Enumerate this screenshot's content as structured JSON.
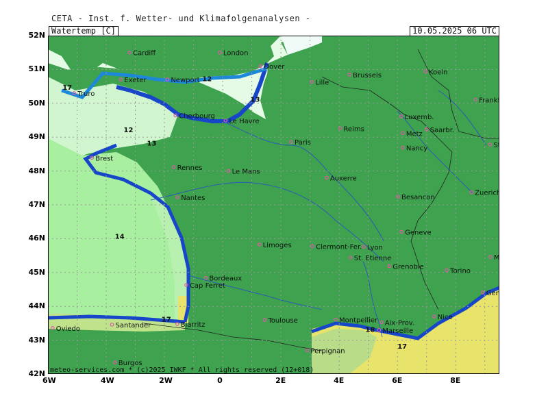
{
  "header": {
    "title": "CETA - Inst. f. Wetter- und Klimafolgenanalysen -"
  },
  "param_box": "Watertemp [C]",
  "date_box": "10.05.2025 06 UTC",
  "footer": "meteo-services.com * (c)2025 IWKF * All rights reserved (12+018)",
  "lat_labels": [
    "52N",
    "51N",
    "50N",
    "49N",
    "48N",
    "47N",
    "46N",
    "45N",
    "44N",
    "43N",
    "42N"
  ],
  "lon_labels": [
    "6W",
    "4W",
    "2W",
    "0",
    "2E",
    "4E",
    "6E",
    "8E"
  ],
  "cities": [
    {
      "name": "Cardiff",
      "lon": -3.2,
      "lat": 51.5
    },
    {
      "name": "London",
      "lon": -0.1,
      "lat": 51.5
    },
    {
      "name": "Dover",
      "lon": 1.3,
      "lat": 51.1
    },
    {
      "name": "Exeter",
      "lon": -3.5,
      "lat": 50.7
    },
    {
      "name": "Newport",
      "lon": -1.9,
      "lat": 50.7
    },
    {
      "name": "Truro",
      "lon": -5.1,
      "lat": 50.3
    },
    {
      "name": "Lille",
      "lon": 3.06,
      "lat": 50.63
    },
    {
      "name": "Brussels",
      "lon": 4.35,
      "lat": 50.85
    },
    {
      "name": "Koeln",
      "lon": 6.96,
      "lat": 50.94
    },
    {
      "name": "Frankfurt",
      "lon": 8.68,
      "lat": 50.11
    },
    {
      "name": "Le Havre",
      "lon": 0.1,
      "lat": 49.49
    },
    {
      "name": "Cherbourg",
      "lon": -1.62,
      "lat": 49.64
    },
    {
      "name": "Reims",
      "lon": 4.03,
      "lat": 49.26
    },
    {
      "name": "Luxemb.",
      "lon": 6.13,
      "lat": 49.61
    },
    {
      "name": "Metz",
      "lon": 6.18,
      "lat": 49.12
    },
    {
      "name": "Saarbr.",
      "lon": 7.0,
      "lat": 49.23
    },
    {
      "name": "Paris",
      "lon": 2.35,
      "lat": 48.86
    },
    {
      "name": "Nancy",
      "lon": 6.18,
      "lat": 48.69
    },
    {
      "name": "Stuttgart",
      "lon": 9.18,
      "lat": 48.78
    },
    {
      "name": "Brest",
      "lon": -4.49,
      "lat": 48.39
    },
    {
      "name": "Rennes",
      "lon": -1.68,
      "lat": 48.11
    },
    {
      "name": "Le Mans",
      "lon": 0.2,
      "lat": 48.0
    },
    {
      "name": "Auxerre",
      "lon": 3.57,
      "lat": 47.8
    },
    {
      "name": "Nantes",
      "lon": -1.55,
      "lat": 47.22
    },
    {
      "name": "Besancon",
      "lon": 6.02,
      "lat": 47.24
    },
    {
      "name": "Zuerich",
      "lon": 8.54,
      "lat": 47.37
    },
    {
      "name": "Geneve",
      "lon": 6.14,
      "lat": 46.2
    },
    {
      "name": "Limoges",
      "lon": 1.26,
      "lat": 45.83
    },
    {
      "name": "Clermont-Fer.",
      "lon": 3.08,
      "lat": 45.78
    },
    {
      "name": "Lyon",
      "lon": 4.84,
      "lat": 45.76
    },
    {
      "name": "St. Etienne",
      "lon": 4.39,
      "lat": 45.44
    },
    {
      "name": "Grenoble",
      "lon": 5.72,
      "lat": 45.19
    },
    {
      "name": "Milano",
      "lon": 9.19,
      "lat": 45.46
    },
    {
      "name": "Torino",
      "lon": 7.69,
      "lat": 45.07
    },
    {
      "name": "Bordeaux",
      "lon": -0.58,
      "lat": 44.84
    },
    {
      "name": "Cap Ferret",
      "lon": -1.25,
      "lat": 44.63
    },
    {
      "name": "Genova",
      "lon": 8.93,
      "lat": 44.41
    },
    {
      "name": "Nice",
      "lon": 7.26,
      "lat": 43.7
    },
    {
      "name": "Montpellier",
      "lon": 3.88,
      "lat": 43.61
    },
    {
      "name": "Toulouse",
      "lon": 1.44,
      "lat": 43.6
    },
    {
      "name": "Aix-Prov.",
      "lon": 5.45,
      "lat": 43.53
    },
    {
      "name": "Marseille",
      "lon": 5.37,
      "lat": 43.3
    },
    {
      "name": "Biarritz",
      "lon": -1.56,
      "lat": 43.48
    },
    {
      "name": "Oviedo",
      "lon": -5.84,
      "lat": 43.36
    },
    {
      "name": "Santander",
      "lon": -3.8,
      "lat": 43.46
    },
    {
      "name": "Perpignan",
      "lon": 2.9,
      "lat": 42.7
    },
    {
      "name": "Burgos",
      "lon": -3.7,
      "lat": 42.34
    }
  ],
  "sst_labels": [
    {
      "text": "17",
      "lon": -5.5,
      "lat": 50.4
    },
    {
      "text": "12",
      "lon": -0.7,
      "lat": 50.65
    },
    {
      "text": "13",
      "lon": 0.95,
      "lat": 50.05
    },
    {
      "text": "12",
      "lon": -3.4,
      "lat": 49.15
    },
    {
      "text": "13",
      "lon": -2.6,
      "lat": 48.75
    },
    {
      "text": "14",
      "lon": -3.7,
      "lat": 46.0
    },
    {
      "text": "17",
      "lon": -2.1,
      "lat": 43.55
    },
    {
      "text": "18",
      "lon": 4.9,
      "lat": 43.25
    },
    {
      "text": "17",
      "lon": 6.0,
      "lat": 42.75
    }
  ],
  "colors": {
    "land": "#3ea24e",
    "sea_cold": "#e6fbe6",
    "sea_12": "#d0f5cf",
    "sea_14": "#a8f0a0",
    "sea_17": "#bfe28a",
    "sea_18": "#e8e36a",
    "coast_blue": "#1747c8",
    "coast_mid": "#1e88d8",
    "river": "#2a4fc8",
    "city_dot": "#e05aa8",
    "grid": "#9a9a9a"
  }
}
